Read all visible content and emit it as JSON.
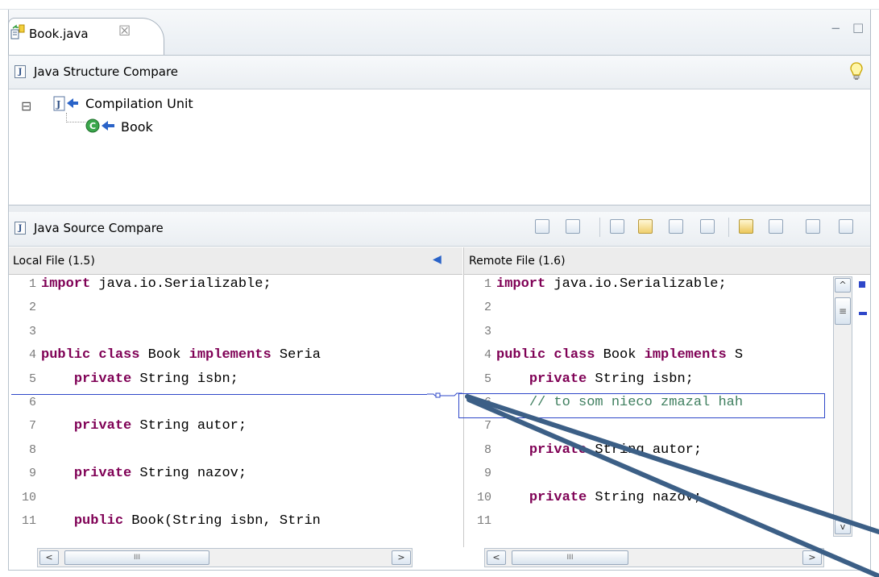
{
  "editor": {
    "tab_title": "Book.java",
    "tab_close_glyph": "☒",
    "minimize_glyph": "−",
    "maximize_glyph": "□"
  },
  "structure_pane": {
    "title": "Java Structure Compare",
    "tree": {
      "root_label": "Compilation Unit",
      "collapse_glyph": "⊟",
      "children": [
        {
          "label": "Book"
        }
      ]
    },
    "hint_icon": "lightbulb-icon"
  },
  "source_pane": {
    "title": "Java Source Compare",
    "toolbar_icons": [
      "show-ancestor-icon",
      "swap-panes-icon",
      "copy-all-left-to-right-icon",
      "copy-all-right-to-left-icon",
      "copy-current-left-to-right-icon",
      "copy-current-right-to-left-icon",
      "next-difference-icon",
      "previous-difference-icon",
      "next-change-icon",
      "previous-change-icon"
    ],
    "left_header": "Local File (1.5)",
    "right_header": "Remote File (1.6)",
    "center_glyph": "◀",
    "left_lines": [
      {
        "num": "1",
        "parts": [
          {
            "t": "import",
            "k": 1
          },
          {
            "t": " java.io.Serializable;"
          }
        ]
      },
      {
        "num": "2",
        "parts": []
      },
      {
        "num": "3",
        "parts": []
      },
      {
        "num": "4",
        "parts": [
          {
            "t": "public",
            "k": 1
          },
          {
            "t": " "
          },
          {
            "t": "class",
            "k": 1
          },
          {
            "t": " Book "
          },
          {
            "t": "implements",
            "k": 1
          },
          {
            "t": " Seria"
          }
        ]
      },
      {
        "num": "5",
        "parts": [
          {
            "t": "    "
          },
          {
            "t": "private",
            "k": 1
          },
          {
            "t": " String isbn;"
          }
        ]
      },
      {
        "num": "6",
        "parts": []
      },
      {
        "num": "7",
        "parts": [
          {
            "t": "    "
          },
          {
            "t": "private",
            "k": 1
          },
          {
            "t": " String autor;"
          }
        ]
      },
      {
        "num": "8",
        "parts": []
      },
      {
        "num": "9",
        "parts": [
          {
            "t": "    "
          },
          {
            "t": "private",
            "k": 1
          },
          {
            "t": " String nazov;"
          }
        ]
      },
      {
        "num": "10",
        "parts": []
      },
      {
        "num": "11",
        "parts": [
          {
            "t": "    "
          },
          {
            "t": "public",
            "k": 1
          },
          {
            "t": " Book(String isbn, Strin"
          }
        ]
      }
    ],
    "right_lines": [
      {
        "num": "1",
        "parts": [
          {
            "t": "import",
            "k": 1
          },
          {
            "t": " java.io.Serializable;"
          }
        ]
      },
      {
        "num": "2",
        "parts": []
      },
      {
        "num": "3",
        "parts": []
      },
      {
        "num": "4",
        "parts": [
          {
            "t": "public",
            "k": 1
          },
          {
            "t": " "
          },
          {
            "t": "class",
            "k": 1
          },
          {
            "t": " Book "
          },
          {
            "t": "implements",
            "k": 1
          },
          {
            "t": " S"
          }
        ]
      },
      {
        "num": "5",
        "parts": [
          {
            "t": "    "
          },
          {
            "t": "private",
            "k": 1
          },
          {
            "t": " String isbn;"
          }
        ]
      },
      {
        "num": "6",
        "parts": [
          {
            "t": "    "
          },
          {
            "t": "// to som nieco zmazal hah",
            "c": 1
          }
        ]
      },
      {
        "num": "7",
        "parts": []
      },
      {
        "num": "8",
        "parts": [
          {
            "t": "    "
          },
          {
            "t": "private",
            "k": 1
          },
          {
            "t": " String autor;"
          }
        ]
      },
      {
        "num": "9",
        "parts": []
      },
      {
        "num": "10",
        "parts": [
          {
            "t": "    "
          },
          {
            "t": "private",
            "k": 1
          },
          {
            "t": " String nazov;"
          }
        ]
      },
      {
        "num": "11",
        "parts": []
      }
    ],
    "scroll_left_glyph": "<",
    "scroll_right_glyph": ">",
    "scroll_up_glyph": "^",
    "scroll_down_glyph": "v",
    "thumb_grip": "III",
    "vthumb_grip": "≡"
  },
  "colors": {
    "keyword": "#7f0055",
    "comment": "#3f7f5f",
    "diff_highlight": "#2e47c9",
    "annotation_arrow": "#3c5f86"
  }
}
